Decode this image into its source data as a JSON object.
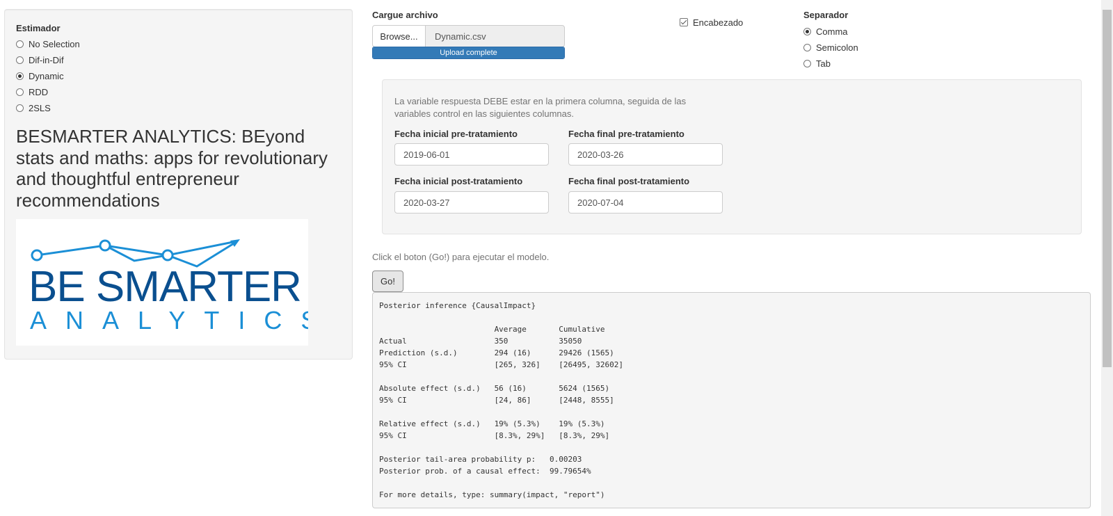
{
  "sidebar": {
    "estimator_label": "Estimador",
    "estimator_options": [
      {
        "label": "No Selection",
        "selected": false
      },
      {
        "label": "Dif-in-Dif",
        "selected": false
      },
      {
        "label": "Dynamic",
        "selected": true
      },
      {
        "label": "RDD",
        "selected": false
      },
      {
        "label": "2SLS",
        "selected": false
      }
    ],
    "brand_title": "BESMARTER ANALYTICS: BEyond stats and maths: apps for revolutionary and thoughtful entrepreneur recommendations",
    "logo": {
      "line1": "BE SMARTER",
      "line2": "ANALYTICS",
      "color_dark": "#0a4f8f",
      "color_light": "#1b8fd6"
    }
  },
  "upload": {
    "label": "Cargue archivo",
    "browse_label": "Browse...",
    "file_name": "Dynamic.csv",
    "progress_text": "Upload complete",
    "progress_fraction": 1.0
  },
  "header_checkbox": {
    "label": "Encabezado",
    "checked": true
  },
  "separator": {
    "label": "Separador",
    "options": [
      {
        "label": "Comma",
        "selected": true
      },
      {
        "label": "Semicolon",
        "selected": false
      },
      {
        "label": "Tab",
        "selected": false
      }
    ]
  },
  "dates_panel": {
    "note": "La variable respuesta DEBE estar en la primera columna, seguida de las variables control en las siguientes columnas.",
    "pre_start": {
      "label": "Fecha inicial pre-tratamiento",
      "value": "2019-06-01"
    },
    "pre_end": {
      "label": "Fecha final pre-tratamiento",
      "value": "2020-03-26"
    },
    "post_start": {
      "label": "Fecha inicial post-tratamiento",
      "value": "2020-03-27"
    },
    "post_end": {
      "label": "Fecha final post-tratamiento",
      "value": "2020-07-04"
    }
  },
  "run": {
    "help_text": "Click el boton (Go!) para ejecutar el modelo.",
    "go_label": "Go!"
  },
  "output_text": "Posterior inference {CausalImpact}\n\n                         Average       Cumulative\nActual                   350           35050\nPrediction (s.d.)        294 (16)      29426 (1565)\n95% CI                   [265, 326]    [26495, 32602]\n\nAbsolute effect (s.d.)   56 (16)       5624 (1565)\n95% CI                   [24, 86]      [2448, 8555]\n\nRelative effect (s.d.)   19% (5.3%)    19% (5.3%)\n95% CI                   [8.3%, 29%]   [8.3%, 29%]\n\nPosterior tail-area probability p:   0.00203\nPosterior prob. of a causal effect:  99.79654%\n\nFor more details, type: summary(impact, \"report\")",
  "colors": {
    "accent": "#337ab7",
    "panel_bg": "#f5f5f5"
  }
}
